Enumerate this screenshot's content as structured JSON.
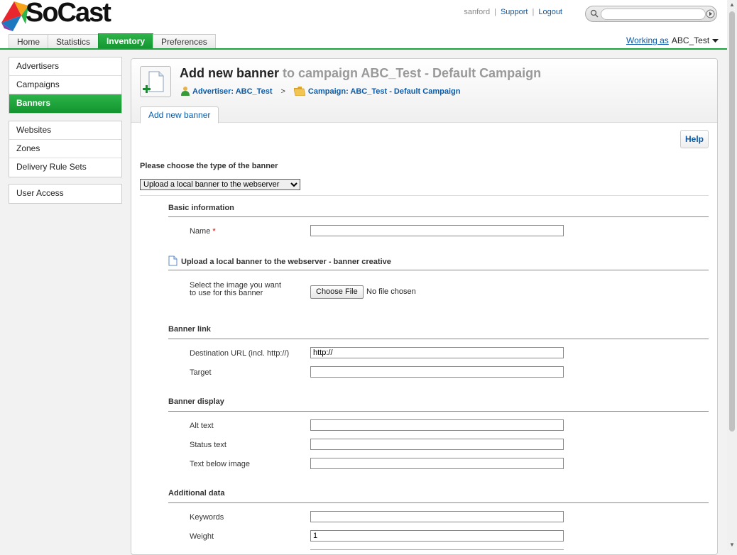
{
  "header": {
    "logo_text": "SoCast",
    "username": "sanford",
    "support_link": "Support",
    "logout_link": "Logout",
    "search_placeholder": ""
  },
  "nav_tabs": [
    {
      "label": "Home"
    },
    {
      "label": "Statistics"
    },
    {
      "label": "Inventory",
      "active": true
    },
    {
      "label": "Preferences"
    }
  ],
  "working_as": {
    "label": "Working as",
    "account": "ABC_Test"
  },
  "sidebar": {
    "group1": [
      {
        "label": "Advertisers"
      },
      {
        "label": "Campaigns"
      },
      {
        "label": "Banners",
        "active": true
      }
    ],
    "group2": [
      {
        "label": "Websites"
      },
      {
        "label": "Zones"
      },
      {
        "label": "Delivery Rule Sets"
      }
    ],
    "group3": [
      {
        "label": "User Access"
      }
    ]
  },
  "page": {
    "title_main": "Add new banner",
    "title_context": "to campaign ABC_Test - Default Campaign",
    "breadcrumb_advertiser": "Advertiser: ABC_Test",
    "breadcrumb_separator": ">",
    "breadcrumb_campaign": "Campaign: ABC_Test - Default Campaign",
    "subtab": "Add new banner",
    "help": "Help"
  },
  "form": {
    "choose_type_label": "Please choose the type of the banner",
    "type_selected": "Upload a local banner to the webserver",
    "sections": {
      "basic": "Basic information",
      "upload": "Upload a local banner to the webserver - banner creative",
      "link": "Banner link",
      "display": "Banner display",
      "additional": "Additional data"
    },
    "fields": {
      "name_label": "Name",
      "required_mark": "*",
      "name_value": "",
      "image_label_line1": "Select the image you want",
      "image_label_line2": "to use for this banner",
      "choose_file": "Choose File",
      "no_file": "No file chosen",
      "dest_url_label": "Destination URL (incl. http://)",
      "dest_url_value": "http://",
      "target_label": "Target",
      "target_value": "",
      "alt_label": "Alt text",
      "alt_value": "",
      "status_label": "Status text",
      "status_value": "",
      "below_label": "Text below image",
      "below_value": "",
      "keywords_label": "Keywords",
      "keywords_value": "",
      "weight_label": "Weight",
      "weight_value": "1"
    }
  },
  "colors": {
    "accent_green": "#1aa33a",
    "link_blue": "#0a5aa8",
    "required_red": "#d00000"
  }
}
